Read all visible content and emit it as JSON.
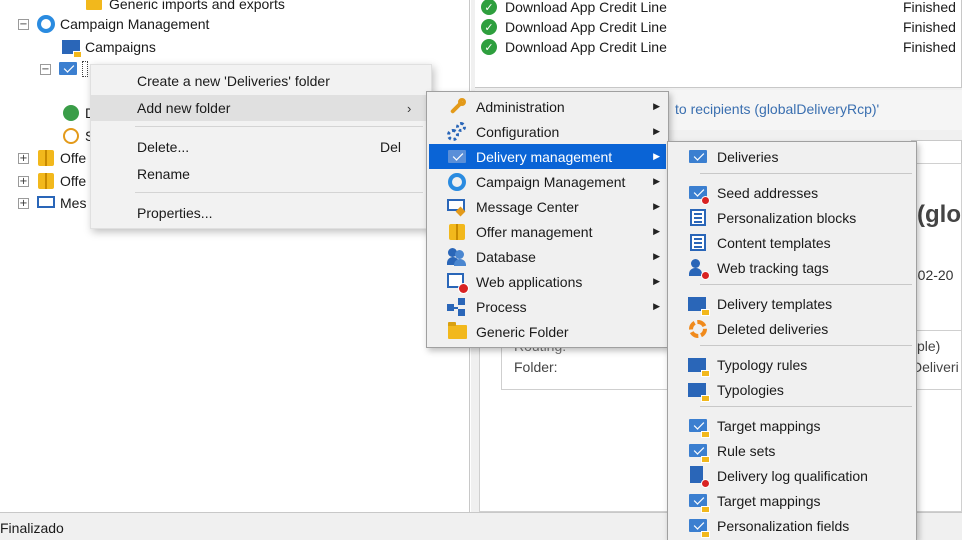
{
  "tree": {
    "partial_top": "Generic imports and exports",
    "campaign_management": "Campaign Management",
    "campaigns": "Campaigns",
    "cut_rows": [
      {
        "label": "D",
        "icon": "calculator-icon"
      },
      {
        "label": "S",
        "icon": "play-icon"
      },
      {
        "label": "Offe",
        "icon": "offer-gift-icon"
      },
      {
        "label": "Offe",
        "icon": "offer-gift-icon"
      },
      {
        "label": "Mes",
        "icon": "message-center-icon"
      }
    ]
  },
  "grid": {
    "rows": [
      {
        "label": "Download App Credit Line",
        "status": "Finished"
      },
      {
        "label": "Download App Credit Line",
        "status": "Finished"
      },
      {
        "label": "Download App Credit Line",
        "status": "Finished"
      }
    ]
  },
  "detail": {
    "link_fragment": "to recipients (globalDeliveryRcp)'",
    "title_fragment": "(glo",
    "date_fragment": "-02-20",
    "routing_label": "Routing:",
    "folder_label": "Folder:",
    "value_fragment_1": "ple)",
    "value_fragment_2": "Deliveri"
  },
  "status_bar": {
    "text": "Finalizado"
  },
  "context_menu": {
    "items": [
      {
        "label": "Create a new 'Deliveries' folder",
        "shortcut": "",
        "submenu": false
      },
      {
        "label": "Add new folder",
        "shortcut": "",
        "submenu": true
      },
      {
        "label": "Delete...",
        "shortcut": "Del",
        "submenu": false
      },
      {
        "label": "Rename",
        "shortcut": "",
        "submenu": false
      },
      {
        "label": "Properties...",
        "shortcut": "",
        "submenu": false
      }
    ]
  },
  "folder_menu": {
    "items": [
      {
        "label": "Administration",
        "icon": "wrench-icon",
        "submenu": true
      },
      {
        "label": "Configuration",
        "icon": "gears-icon",
        "submenu": true
      },
      {
        "label": "Delivery management",
        "icon": "envelope-icon",
        "submenu": true,
        "highlighted": true
      },
      {
        "label": "Campaign Management",
        "icon": "campaign-ring-icon",
        "submenu": true
      },
      {
        "label": "Message Center",
        "icon": "message-center-icon",
        "submenu": true
      },
      {
        "label": "Offer management",
        "icon": "offer-gift-icon",
        "submenu": true
      },
      {
        "label": "Database",
        "icon": "database-users-icon",
        "submenu": true
      },
      {
        "label": "Web applications",
        "icon": "web-app-icon",
        "submenu": true
      },
      {
        "label": "Process",
        "icon": "process-icon",
        "submenu": true
      },
      {
        "label": "Generic Folder",
        "icon": "folder-icon",
        "submenu": false
      }
    ]
  },
  "delivery_menu": {
    "items": [
      {
        "label": "Deliveries",
        "icon": "envelope-icon"
      },
      {
        "label": "Seed addresses",
        "icon": "seed-envelope-icon"
      },
      {
        "label": "Personalization blocks",
        "icon": "list-icon"
      },
      {
        "label": "Content templates",
        "icon": "list-icon"
      },
      {
        "label": "Web tracking tags",
        "icon": "web-tracking-icon"
      },
      {
        "label": "Delivery templates",
        "icon": "template-folder-icon"
      },
      {
        "label": "Deleted deliveries",
        "icon": "recycle-icon"
      },
      {
        "label": "Typology rules",
        "icon": "typology-folder-icon"
      },
      {
        "label": "Typologies",
        "icon": "typology-folder-icon"
      },
      {
        "label": "Target mappings",
        "icon": "mapping-envelope-icon"
      },
      {
        "label": "Rule sets",
        "icon": "rule-envelope-icon"
      },
      {
        "label": "Delivery log qualification",
        "icon": "log-qualification-icon"
      },
      {
        "label": "Target mappings",
        "icon": "mapping-envelope-icon"
      },
      {
        "label": "Personalization fields",
        "icon": "personalization-envelope-icon"
      }
    ]
  },
  "colors": {
    "highlight": "#0a64d6",
    "menu_bg": "#f0f0f0",
    "success": "#2e9f3e",
    "link": "#3a6fb0"
  }
}
